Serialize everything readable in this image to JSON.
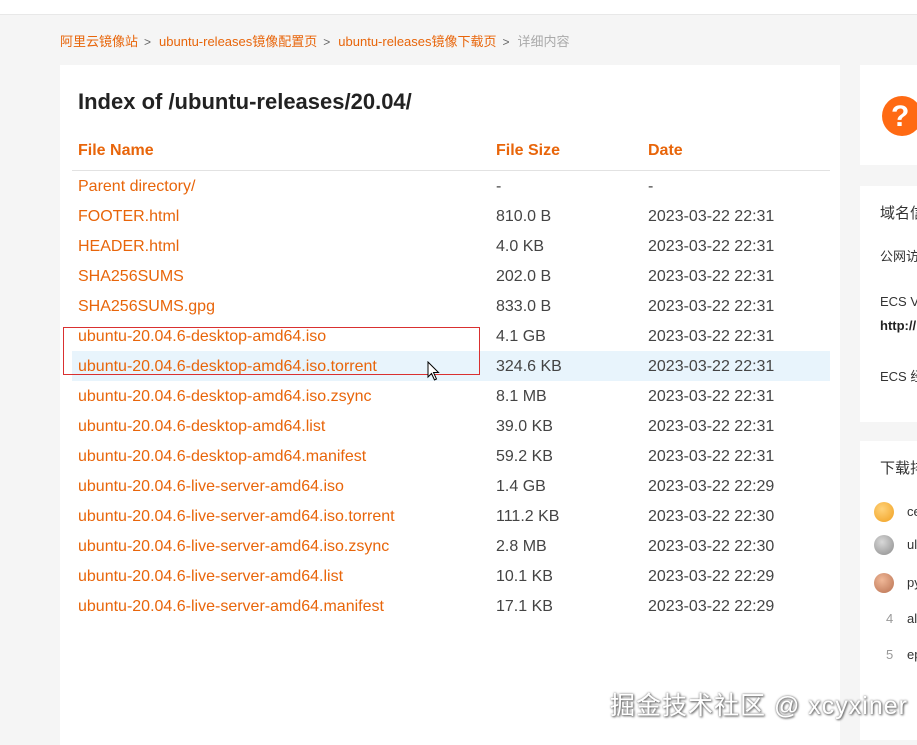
{
  "breadcrumb": {
    "items": [
      "阿里云镜像站",
      "ubuntu-releases镜像配置页",
      "ubuntu-releases镜像下载页"
    ],
    "separator": ">",
    "current": "详细内容"
  },
  "listing": {
    "title": "Index of /ubuntu-releases/20.04/",
    "columns": {
      "name": "File Name",
      "size": "File Size",
      "date": "Date"
    },
    "rows": [
      {
        "name": "Parent directory/",
        "size": "-",
        "date": "-"
      },
      {
        "name": "FOOTER.html",
        "size": "810.0 B",
        "date": "2023-03-22 22:31"
      },
      {
        "name": "HEADER.html",
        "size": "4.0 KB",
        "date": "2023-03-22 22:31"
      },
      {
        "name": "SHA256SUMS",
        "size": "202.0 B",
        "date": "2023-03-22 22:31"
      },
      {
        "name": "SHA256SUMS.gpg",
        "size": "833.0 B",
        "date": "2023-03-22 22:31"
      },
      {
        "name": "ubuntu-20.04.6-desktop-amd64.iso",
        "size": "4.1 GB",
        "date": "2023-03-22 22:31"
      },
      {
        "name": "ubuntu-20.04.6-desktop-amd64.iso.torrent",
        "size": "324.6 KB",
        "date": "2023-03-22 22:31"
      },
      {
        "name": "ubuntu-20.04.6-desktop-amd64.iso.zsync",
        "size": "8.1 MB",
        "date": "2023-03-22 22:31"
      },
      {
        "name": "ubuntu-20.04.6-desktop-amd64.list",
        "size": "39.0 KB",
        "date": "2023-03-22 22:31"
      },
      {
        "name": "ubuntu-20.04.6-desktop-amd64.manifest",
        "size": "59.2 KB",
        "date": "2023-03-22 22:31"
      },
      {
        "name": "ubuntu-20.04.6-live-server-amd64.iso",
        "size": "1.4 GB",
        "date": "2023-03-22 22:29"
      },
      {
        "name": "ubuntu-20.04.6-live-server-amd64.iso.torrent",
        "size": "111.2 KB",
        "date": "2023-03-22 22:30"
      },
      {
        "name": "ubuntu-20.04.6-live-server-amd64.iso.zsync",
        "size": "2.8 MB",
        "date": "2023-03-22 22:30"
      },
      {
        "name": "ubuntu-20.04.6-live-server-amd64.list",
        "size": "10.1 KB",
        "date": "2023-03-22 22:29"
      },
      {
        "name": "ubuntu-20.04.6-live-server-amd64.manifest",
        "size": "17.1 KB",
        "date": "2023-03-22 22:29"
      }
    ],
    "highlighted_row": "ubuntu-20.04.6-desktop-amd64.iso.torrent"
  },
  "sidebar": {
    "help_icon": "question-icon",
    "domain_box": {
      "heading": "域名信",
      "line1": "公网访",
      "line2": "ECS V",
      "line3": "http://",
      "line4": "ECS 经"
    },
    "download_box": {
      "heading": "下载排",
      "items": [
        {
          "rank": "1",
          "text": "ce"
        },
        {
          "rank": "2",
          "text": "ul"
        },
        {
          "rank": "3",
          "text": "py"
        },
        {
          "rank": "4",
          "text": "al"
        },
        {
          "rank": "5",
          "text": "ep"
        }
      ]
    }
  },
  "watermark": "掘金技术社区 @ xcyxiner",
  "colors": {
    "accent": "#e8650a",
    "highlight_row": "#e8f4fc",
    "annotation_box": "#d93030",
    "icon_orange": "#ff6a13"
  }
}
